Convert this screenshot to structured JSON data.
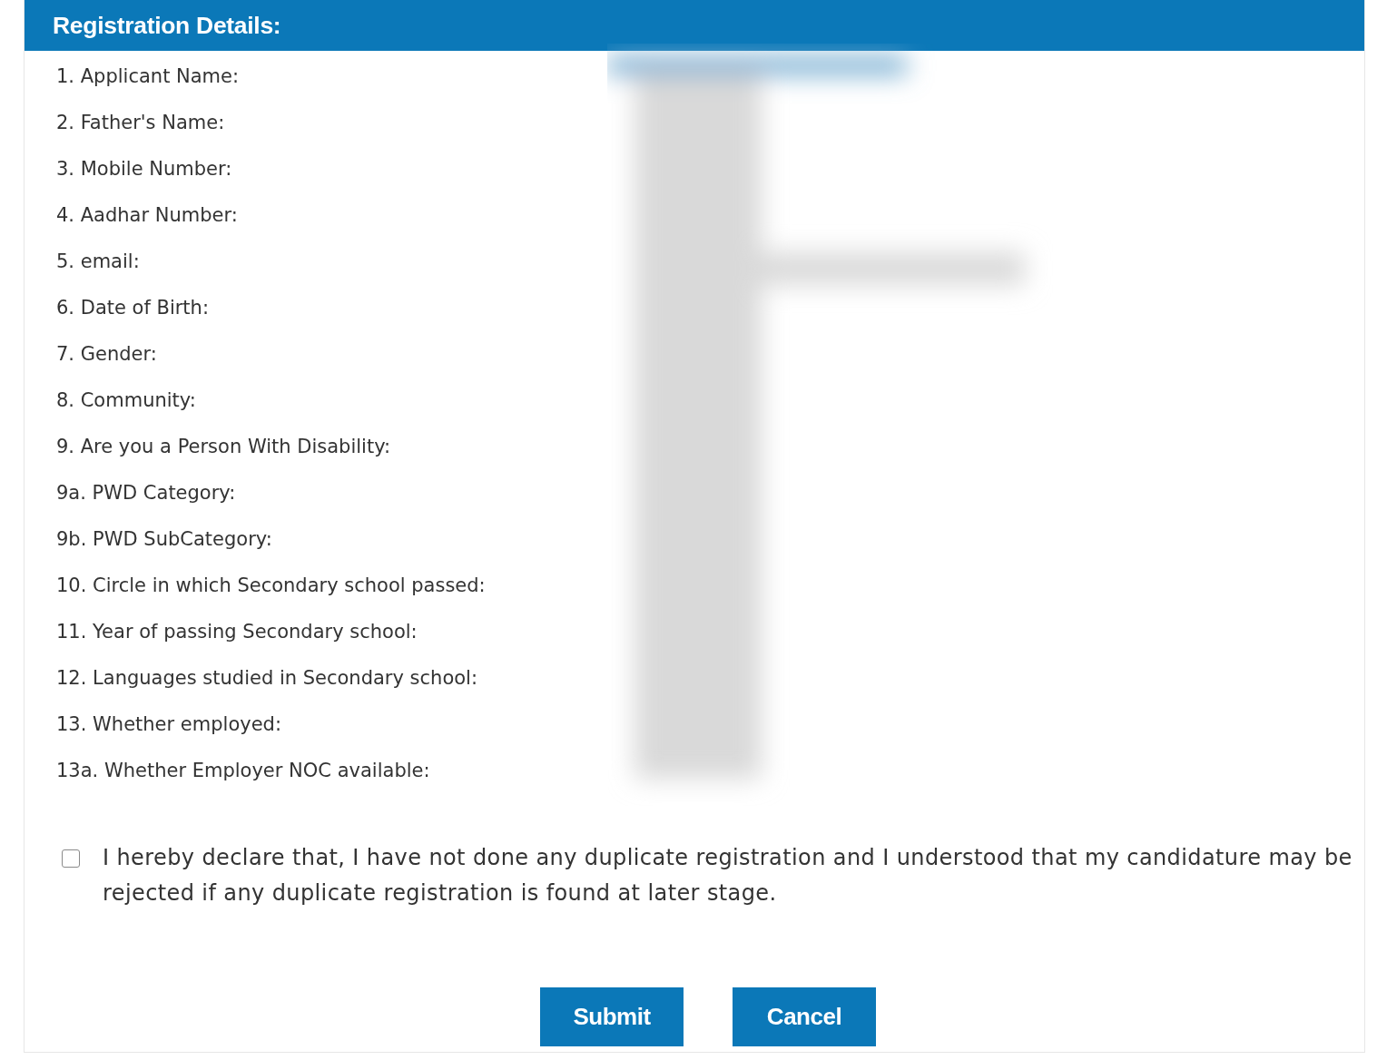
{
  "panel": {
    "title": "Registration Details:",
    "values_blurred": true
  },
  "fields": [
    {
      "label": "1. Applicant Name:"
    },
    {
      "label": "2. Father's Name:"
    },
    {
      "label": "3. Mobile Number:"
    },
    {
      "label": "4. Aadhar Number:"
    },
    {
      "label": "5. email:"
    },
    {
      "label": "6. Date of Birth:"
    },
    {
      "label": "7. Gender:"
    },
    {
      "label": "8. Community:"
    },
    {
      "label": "9. Are you a Person With Disability:"
    },
    {
      "label": "9a. PWD Category:"
    },
    {
      "label": "9b. PWD SubCategory:"
    },
    {
      "label": "10. Circle in which Secondary school passed:"
    },
    {
      "label": "11. Year of passing Secondary school:"
    },
    {
      "label": "12. Languages studied in Secondary school:"
    },
    {
      "label": "13. Whether employed:"
    },
    {
      "label": "13a. Whether Employer NOC available:"
    }
  ],
  "declaration": {
    "checked": false,
    "text": "I hereby declare that, I have not done any duplicate registration and I understood that my candidature may be rejected if any duplicate registration is found at later stage."
  },
  "buttons": [
    "Submit",
    "Cancel"
  ]
}
